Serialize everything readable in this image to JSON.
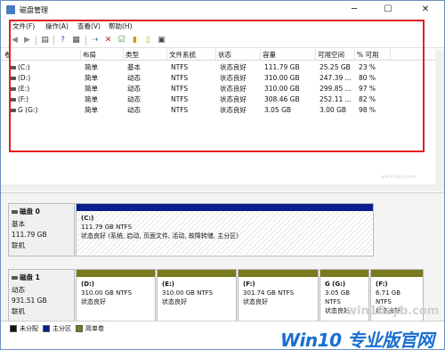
{
  "window": {
    "title": "磁盘管理",
    "minimize": "─",
    "maximize": "☐",
    "close": "✕"
  },
  "menu": [
    "文件(F)",
    "操作(A)",
    "查看(V)",
    "帮助(H)"
  ],
  "volume_table": {
    "columns": [
      "卷",
      "布局",
      "类型",
      "文件系统",
      "状态",
      "容量",
      "可用空间",
      "% 可用"
    ],
    "rows": [
      [
        "(C:)",
        "简单",
        "基本",
        "NTFS",
        "状态良好",
        "111.79 GB",
        "25.25 GB",
        "23 %"
      ],
      [
        "(D:)",
        "简单",
        "动态",
        "NTFS",
        "状态良好",
        "310.00 GB",
        "247.39 ...",
        "80 %"
      ],
      [
        "(E:)",
        "简单",
        "动态",
        "NTFS",
        "状态良好",
        "310.00 GB",
        "299.85 ...",
        "97 %"
      ],
      [
        "(F:)",
        "简单",
        "动态",
        "NTFS",
        "状态良好",
        "308.46 GB",
        "252.11 ...",
        "82 %"
      ],
      [
        "G (G:)",
        "简单",
        "动态",
        "NTFS",
        "状态良好",
        "3.05 GB",
        "3.00 GB",
        "98 %"
      ]
    ]
  },
  "watermark": "win10zyb.com",
  "disks": [
    {
      "name": "磁盘 0",
      "type": "基本",
      "size": "111.79 GB",
      "status": "联机",
      "partitions": [
        {
          "name": "(C:)",
          "size_fs": "111.79 GB NTFS",
          "status": "状态良好 (系统, 启动, 页面文件, 活动, 故障转储, 主分区)"
        }
      ]
    },
    {
      "name": "磁盘 1",
      "type": "动态",
      "size": "931.51 GB",
      "status": "联机",
      "partitions": [
        {
          "name": "(D:)",
          "size_fs": "310.00 GB NTFS",
          "status": "状态良好"
        },
        {
          "name": "(E:)",
          "size_fs": "310.00 GB NTFS",
          "status": "状态良好"
        },
        {
          "name": "(F:)",
          "size_fs": "301.74 GB NTFS",
          "status": "状态良好"
        },
        {
          "name": "G (G:)",
          "size_fs": "3.05 GB NTFS",
          "status": "状态良好"
        },
        {
          "name": "(F:)",
          "size_fs": "6.71 GB NTFS",
          "status": "状态良好"
        }
      ]
    }
  ],
  "legend": [
    "未分配",
    "主分区",
    "简单卷"
  ],
  "colors": {
    "primary_partition": "#0a1f8f",
    "simple_volume": "#7a7a1e",
    "unallocated": "#111111",
    "highlight_box": "#e02020",
    "brand_blue": "#1a6fd0"
  },
  "brand": {
    "main": "Win10 专业版官网",
    "site": "win10zyb.com"
  }
}
